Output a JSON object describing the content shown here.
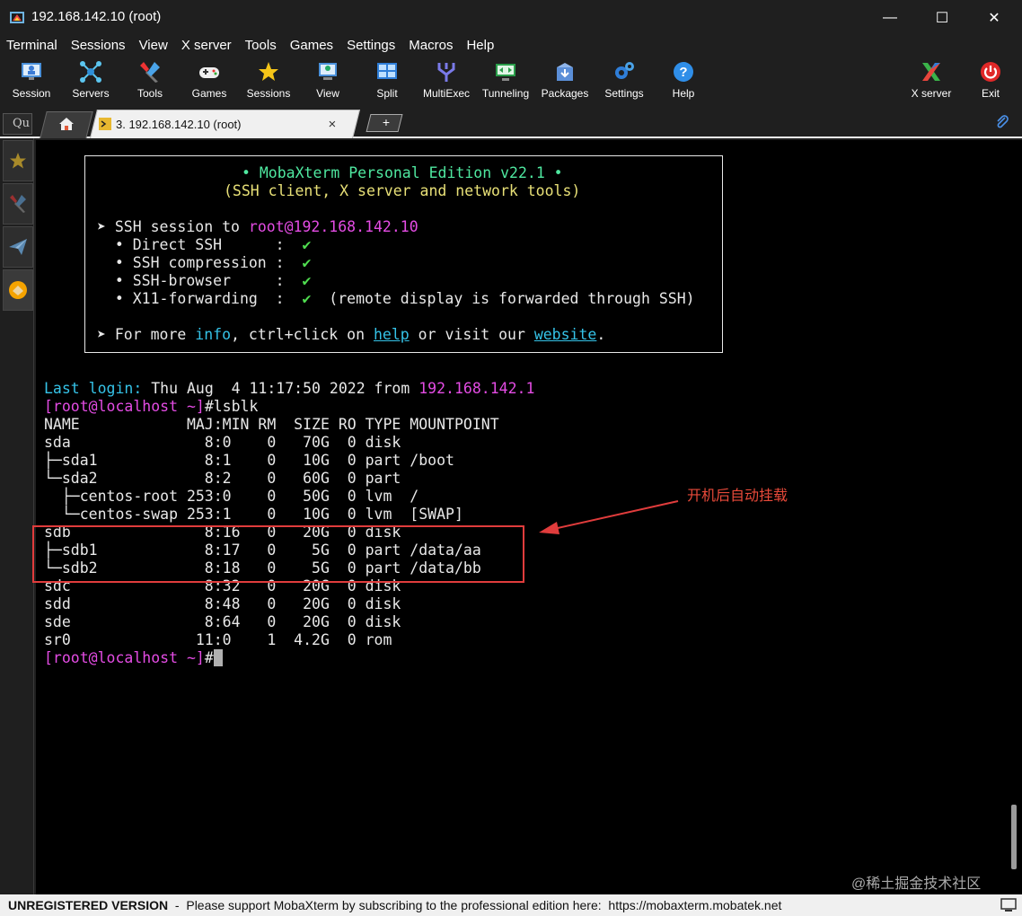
{
  "window": {
    "title": "192.168.142.10 (root)",
    "minimize": "—",
    "maximize": "☐",
    "close": "✕"
  },
  "menu": [
    "Terminal",
    "Sessions",
    "View",
    "X server",
    "Tools",
    "Games",
    "Settings",
    "Macros",
    "Help"
  ],
  "toolbar": {
    "items": [
      "Session",
      "Servers",
      "Tools",
      "Games",
      "Sessions",
      "View",
      "Split",
      "MultiExec",
      "Tunneling",
      "Packages",
      "Settings",
      "Help"
    ],
    "right_items": [
      "X server",
      "Exit"
    ]
  },
  "tabs": {
    "quick_connect": "Qu",
    "session_tab_label": "3. 192.168.142.10 (root)",
    "close": "×",
    "new_tab": "+"
  },
  "terminal": {
    "banner": {
      "title": "• MobaXterm Personal Edition v22.1 •",
      "subtitle": "(SSH client, X server and network tools)",
      "session_prefix": "➤ SSH session to ",
      "session_host": "root@192.168.142.10",
      "lines": [
        {
          "label": "  • Direct SSH      :  ",
          "mark": "✔",
          "note": ""
        },
        {
          "label": "  • SSH compression :  ",
          "mark": "✔",
          "note": ""
        },
        {
          "label": "  • SSH-browser     :  ",
          "mark": "✔",
          "note": ""
        },
        {
          "label": "  • X11-forwarding  :  ",
          "mark": "✔",
          "note": "  (remote display is forwarded through SSH)"
        }
      ],
      "more_prefix": "➤ For more ",
      "more_info": "info",
      "more_mid": ", ctrl+click on ",
      "more_help": "help",
      "more_mid2": " or visit our ",
      "more_website": "website",
      "more_end": "."
    },
    "last_login_label": "Last login:",
    "last_login_text": " Thu Aug  4 11:17:50 2022 from ",
    "last_login_ip": "192.168.142.1",
    "prompt": "[root@localhost ~]",
    "prompt_symbol": "#",
    "command": "lsblk",
    "lsblk_output": [
      "NAME            MAJ:MIN RM  SIZE RO TYPE MOUNTPOINT",
      "sda               8:0    0   70G  0 disk",
      "├─sda1            8:1    0   10G  0 part /boot",
      "└─sda2            8:2    0   60G  0 part",
      "  ├─centos-root 253:0    0   50G  0 lvm  /",
      "  └─centos-swap 253:1    0   10G  0 lvm  [SWAP]",
      "sdb               8:16   0   20G  0 disk",
      "├─sdb1            8:17   0    5G  0 part /data/aa",
      "└─sdb2            8:18   0    5G  0 part /data/bb",
      "sdc               8:32   0   20G  0 disk",
      "sdd               8:48   0   20G  0 disk",
      "sde               8:64   0   20G  0 disk",
      "sr0              11:0    1  4.2G  0 rom"
    ]
  },
  "annotation": "开机后自动挂载",
  "watermark": "@稀土掘金技术社区",
  "status": {
    "unregistered": "UNREGISTERED VERSION",
    "message": "  -  Please support MobaXterm by subscribing to the professional edition here:  ",
    "url": "https://mobaxterm.mobatek.net"
  }
}
